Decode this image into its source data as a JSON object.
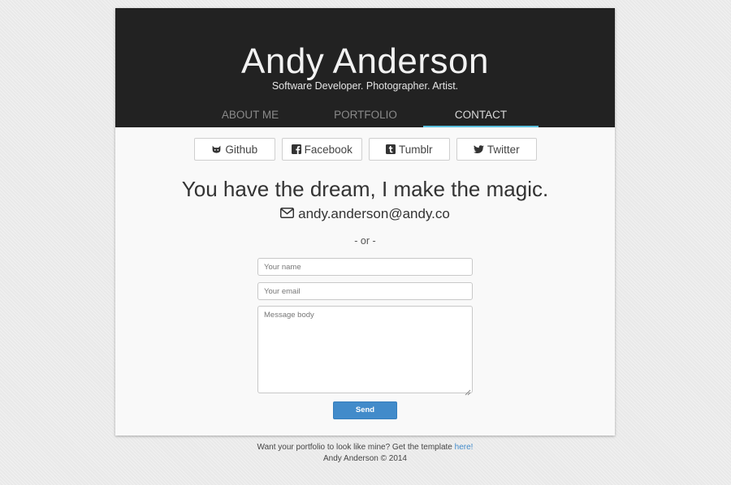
{
  "header": {
    "title": "Andy Anderson",
    "tagline": "Software Developer. Photographer. Artist."
  },
  "nav": {
    "tabs": [
      {
        "label": "ABOUT ME",
        "active": false
      },
      {
        "label": "PORTFOLIO",
        "active": false
      },
      {
        "label": "CONTACT",
        "active": true
      }
    ],
    "accent_color": "#5bc0de"
  },
  "social": [
    {
      "label": "Github",
      "icon": "github-icon"
    },
    {
      "label": "Facebook",
      "icon": "facebook-icon"
    },
    {
      "label": "Tumblr",
      "icon": "tumblr-icon"
    },
    {
      "label": "Twitter",
      "icon": "twitter-icon"
    }
  ],
  "contact": {
    "headline": "You have the dream, I make the magic.",
    "email": "andy.anderson@andy.co",
    "email_icon": "envelope-icon",
    "separator": "- or -"
  },
  "form": {
    "name_placeholder": "Your name",
    "name_value": "",
    "email_placeholder": "Your email",
    "email_value": "",
    "message_placeholder": "Message body",
    "message_value": "",
    "send_label": "Send",
    "send_color": "#428bca"
  },
  "footer": {
    "prompt": "Want your portfolio to look like mine? Get the template ",
    "link_text": "here!",
    "copyright": "Andy Anderson © 2014"
  }
}
